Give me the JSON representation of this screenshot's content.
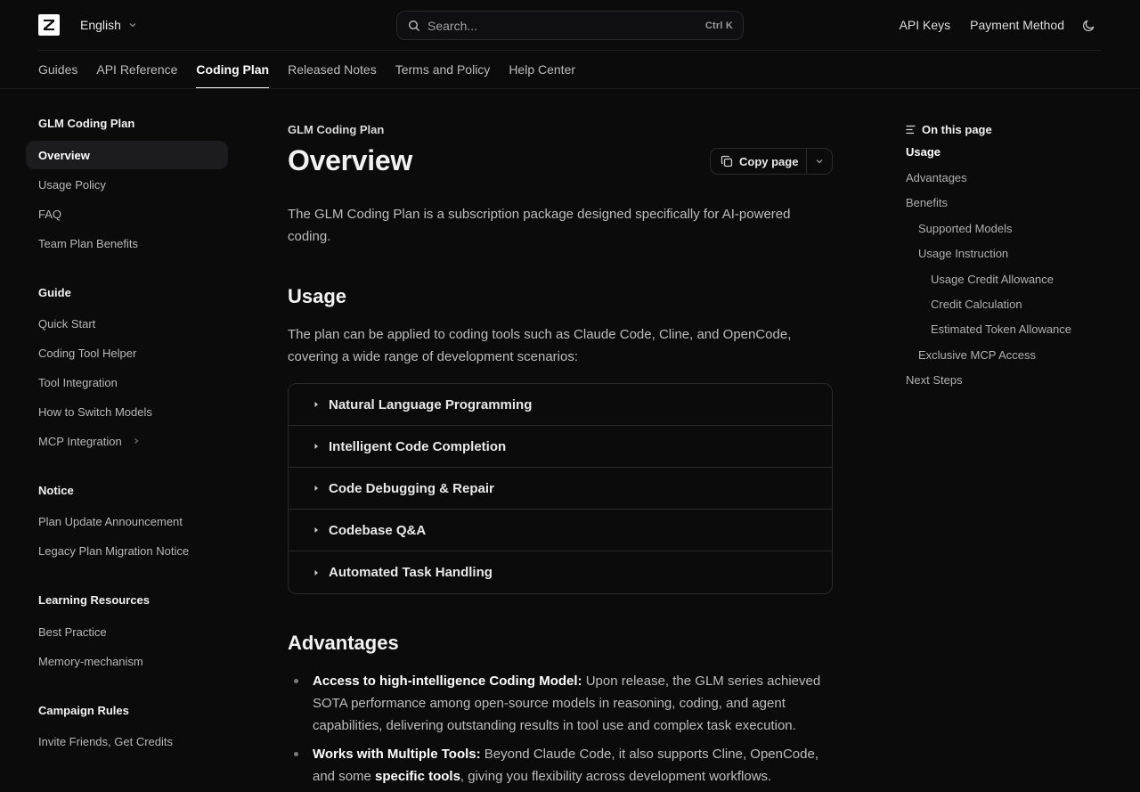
{
  "header": {
    "language": "English",
    "search_placeholder": "Search...",
    "search_shortcut": "Ctrl K",
    "links": [
      "API Keys",
      "Payment Method"
    ]
  },
  "tabs": [
    {
      "label": "Guides"
    },
    {
      "label": "API Reference"
    },
    {
      "label": "Coding Plan",
      "active": true
    },
    {
      "label": "Released Notes"
    },
    {
      "label": "Terms and Policy"
    },
    {
      "label": "Help Center"
    }
  ],
  "sidebar": {
    "sections": [
      {
        "title": "GLM Coding Plan",
        "items": [
          "Overview",
          "Usage Policy",
          "FAQ",
          "Team Plan Benefits"
        ]
      },
      {
        "title": "Guide",
        "items": [
          "Quick Start",
          "Coding Tool Helper",
          "Tool Integration",
          "How to Switch Models",
          "MCP Integration"
        ]
      },
      {
        "title": "Notice",
        "items": [
          "Plan Update Announcement",
          "Legacy Plan Migration Notice"
        ]
      },
      {
        "title": "Learning Resources",
        "items": [
          "Best Practice",
          "Memory-mechanism"
        ]
      },
      {
        "title": "Campaign Rules",
        "items": [
          "Invite Friends, Get Credits"
        ]
      }
    ],
    "active_item": "Overview"
  },
  "main": {
    "eyebrow": "GLM Coding Plan",
    "title": "Overview",
    "copy_label": "Copy page",
    "lead": "The GLM Coding Plan is a subscription package designed specifically for AI-powered coding.",
    "usage_heading": "Usage",
    "usage_text": "The plan can be applied to coding tools such as Claude Code, Cline, and OpenCode, covering a wide range of development scenarios:",
    "accordion": [
      "Natural Language Programming",
      "Intelligent Code Completion",
      "Code Debugging & Repair",
      "Codebase Q&A",
      "Automated Task Handling"
    ],
    "advantages_heading": "Advantages",
    "advantages": [
      {
        "bold": "Access to high-intelligence Coding Model:",
        "text": " Upon release, the GLM series achieved SOTA performance among open-source models in reasoning, coding, and agent capabilities, delivering outstanding results in tool use and complex task execution."
      },
      {
        "bold": "Works with Multiple Tools:",
        "text": " Beyond Claude Code, it also supports Cline, OpenCode, and some ",
        "bold2": "specific tools",
        "text2": ", giving you flexibility across development workflows."
      }
    ]
  },
  "toc": {
    "heading": "On this page",
    "items": [
      {
        "label": "Usage",
        "level": 0,
        "active": true
      },
      {
        "label": "Advantages",
        "level": 0
      },
      {
        "label": "Benefits",
        "level": 0
      },
      {
        "label": "Supported Models",
        "level": 1
      },
      {
        "label": "Usage Instruction",
        "level": 1
      },
      {
        "label": "Usage Credit Allowance",
        "level": 2
      },
      {
        "label": "Credit Calculation",
        "level": 2
      },
      {
        "label": "Estimated Token Allowance",
        "level": 2
      },
      {
        "label": "Exclusive MCP Access",
        "level": 1
      },
      {
        "label": "Next Steps",
        "level": 0
      }
    ]
  }
}
